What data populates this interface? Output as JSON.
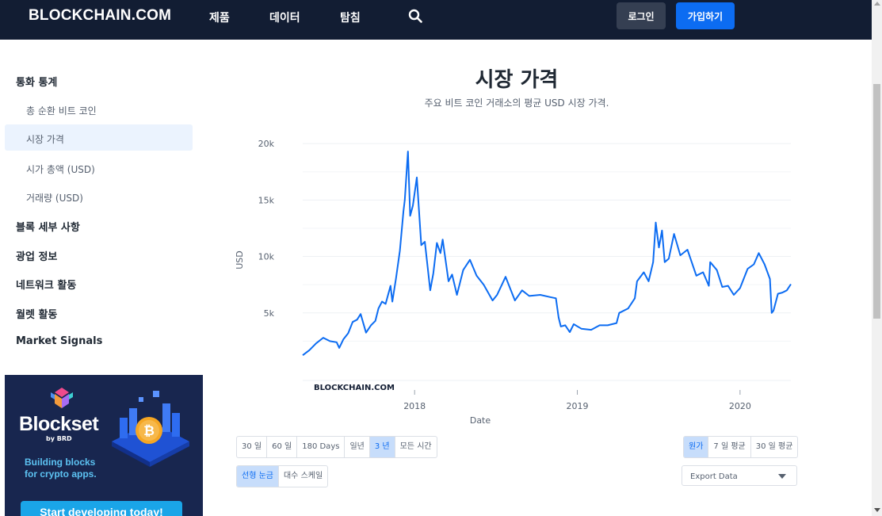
{
  "header": {
    "logo": "BLOCKCHAIN.COM",
    "nav": [
      "제품",
      "데이터",
      "탐침"
    ],
    "login": "로그인",
    "signup": "가입하기"
  },
  "sidebar": {
    "section1": "통화 통계",
    "sub_items": [
      "총 순환 비트 코인",
      "시장 가격",
      "시가 총액 (USD)",
      "거래량 (USD)"
    ],
    "active_index": 1,
    "sections": [
      "블록 세부 사항",
      "광업 정보",
      "네트워크 활동",
      "월렛 활동",
      "Market Signals"
    ]
  },
  "ad": {
    "title": "Blockset",
    "by": "by BRD",
    "tag_line1": "Building blocks",
    "tag_line2": "for crypto apps.",
    "cta": "Start developing today!"
  },
  "main": {
    "title": "시장 가격",
    "subtitle": "주요 비트 코인 거래소의 평균 USD 시장 가격."
  },
  "chart_data": {
    "type": "line",
    "ylabel": "USD",
    "xlabel": "Date",
    "watermark": "BLOCKCHAIN.COM",
    "yticks": [
      "20k",
      "15k",
      "10k",
      "5k"
    ],
    "ylim": [
      0,
      20500
    ],
    "xticks": [
      "2018",
      "2019",
      "2020"
    ],
    "xlim": [
      "2017-04-25",
      "2020-04-24"
    ],
    "grid": true,
    "line_color": "#0c6cf2",
    "series": [
      {
        "values": [
          [
            "2017-04-25",
            1250
          ],
          [
            "2017-05-10",
            1700
          ],
          [
            "2017-05-25",
            2300
          ],
          [
            "2017-06-10",
            2800
          ],
          [
            "2017-06-25",
            2500
          ],
          [
            "2017-07-10",
            2400
          ],
          [
            "2017-07-16",
            1900
          ],
          [
            "2017-07-25",
            2650
          ],
          [
            "2017-08-05",
            3200
          ],
          [
            "2017-08-15",
            4200
          ],
          [
            "2017-08-25",
            4400
          ],
          [
            "2017-09-02",
            4900
          ],
          [
            "2017-09-14",
            3250
          ],
          [
            "2017-09-25",
            3900
          ],
          [
            "2017-10-05",
            4300
          ],
          [
            "2017-10-12",
            5400
          ],
          [
            "2017-10-20",
            6000
          ],
          [
            "2017-10-28",
            5800
          ],
          [
            "2017-11-08",
            7400
          ],
          [
            "2017-11-12",
            6000
          ],
          [
            "2017-11-20",
            8000
          ],
          [
            "2017-11-29",
            10500
          ],
          [
            "2017-12-07",
            14000
          ],
          [
            "2017-12-10",
            15000
          ],
          [
            "2017-12-17",
            19300
          ],
          [
            "2017-12-22",
            13600
          ],
          [
            "2017-12-28",
            14500
          ],
          [
            "2018-01-06",
            17000
          ],
          [
            "2018-01-16",
            11000
          ],
          [
            "2018-01-24",
            11300
          ],
          [
            "2018-02-05",
            7000
          ],
          [
            "2018-02-12",
            8500
          ],
          [
            "2018-02-20",
            11200
          ],
          [
            "2018-02-28",
            10300
          ],
          [
            "2018-03-05",
            11500
          ],
          [
            "2018-03-18",
            7800
          ],
          [
            "2018-03-26",
            8400
          ],
          [
            "2018-04-06",
            6600
          ],
          [
            "2018-04-20",
            8800
          ],
          [
            "2018-05-05",
            9700
          ],
          [
            "2018-05-20",
            8300
          ],
          [
            "2018-06-05",
            7500
          ],
          [
            "2018-06-25",
            6100
          ],
          [
            "2018-07-05",
            6600
          ],
          [
            "2018-07-24",
            8200
          ],
          [
            "2018-08-05",
            7000
          ],
          [
            "2018-08-14",
            6100
          ],
          [
            "2018-08-30",
            7000
          ],
          [
            "2018-09-15",
            6500
          ],
          [
            "2018-10-10",
            6600
          ],
          [
            "2018-11-01",
            6400
          ],
          [
            "2018-11-14",
            6300
          ],
          [
            "2018-11-20",
            4600
          ],
          [
            "2018-11-25",
            3800
          ],
          [
            "2018-12-05",
            3900
          ],
          [
            "2018-12-15",
            3300
          ],
          [
            "2018-12-24",
            4000
          ],
          [
            "2019-01-10",
            3600
          ],
          [
            "2019-02-01",
            3500
          ],
          [
            "2019-02-20",
            3900
          ],
          [
            "2019-03-10",
            3900
          ],
          [
            "2019-03-30",
            4100
          ],
          [
            "2019-04-05",
            5000
          ],
          [
            "2019-04-25",
            5400
          ],
          [
            "2019-05-10",
            6300
          ],
          [
            "2019-05-15",
            7800
          ],
          [
            "2019-05-30",
            8600
          ],
          [
            "2019-06-10",
            7800
          ],
          [
            "2019-06-20",
            9500
          ],
          [
            "2019-06-26",
            13000
          ],
          [
            "2019-07-03",
            10800
          ],
          [
            "2019-07-10",
            12300
          ],
          [
            "2019-07-16",
            9500
          ],
          [
            "2019-07-25",
            9800
          ],
          [
            "2019-08-06",
            12000
          ],
          [
            "2019-08-20",
            10100
          ],
          [
            "2019-09-05",
            10600
          ],
          [
            "2019-09-25",
            8300
          ],
          [
            "2019-10-10",
            8600
          ],
          [
            "2019-10-23",
            7400
          ],
          [
            "2019-10-26",
            9500
          ],
          [
            "2019-11-10",
            8800
          ],
          [
            "2019-11-22",
            7300
          ],
          [
            "2019-12-05",
            7400
          ],
          [
            "2019-12-18",
            6600
          ],
          [
            "2020-01-01",
            7200
          ],
          [
            "2020-01-18",
            8900
          ],
          [
            "2020-02-01",
            9300
          ],
          [
            "2020-02-12",
            10300
          ],
          [
            "2020-02-25",
            9300
          ],
          [
            "2020-03-08",
            8000
          ],
          [
            "2020-03-12",
            5000
          ],
          [
            "2020-03-16",
            5200
          ],
          [
            "2020-03-26",
            6700
          ],
          [
            "2020-04-05",
            6800
          ],
          [
            "2020-04-15",
            7000
          ],
          [
            "2020-04-24",
            7550
          ]
        ]
      }
    ]
  },
  "controls": {
    "ranges": [
      "30 일",
      "60 일",
      "180 Days",
      "일년",
      "3 년",
      "모든 시간"
    ],
    "range_active": 4,
    "averages": [
      "원가",
      "7 일 평균",
      "30 일 평균"
    ],
    "avg_active": 0,
    "scales": [
      "선형 눈금",
      "대수 스케일"
    ],
    "scale_active": 0,
    "export": "Export Data"
  }
}
